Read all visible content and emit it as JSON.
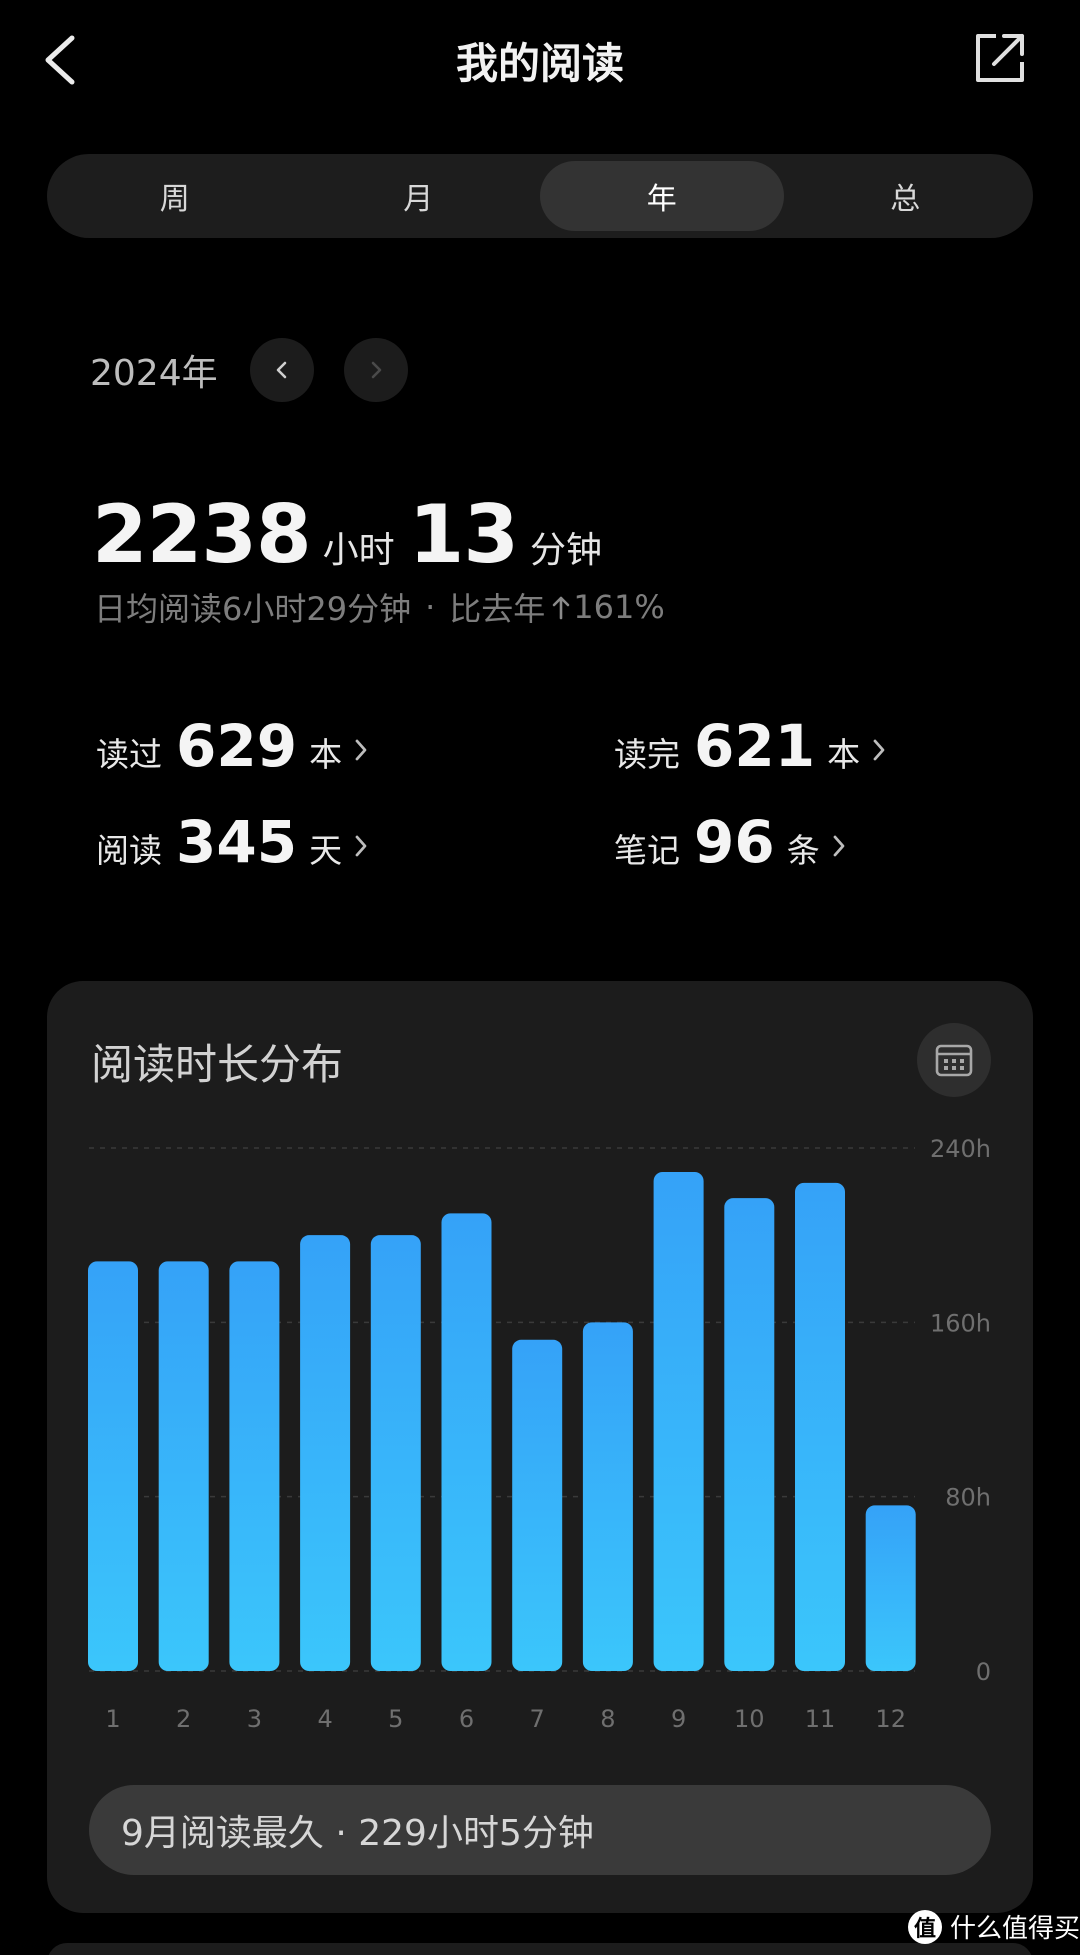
{
  "header": {
    "title": "我的阅读"
  },
  "tabs": [
    {
      "label": "周",
      "active": false
    },
    {
      "label": "月",
      "active": false
    },
    {
      "label": "年",
      "active": true
    },
    {
      "label": "总",
      "active": false
    }
  ],
  "year": {
    "label": "2024年"
  },
  "total": {
    "hours": "2238",
    "hours_unit": "小时",
    "minutes": "13",
    "minutes_unit": "分钟"
  },
  "summary": {
    "daily": "日均阅读6小时29分钟",
    "separator": "·",
    "compare": "比去年",
    "change": "161%"
  },
  "stats": {
    "read": {
      "label": "读过",
      "value": "629",
      "unit": "本"
    },
    "finished": {
      "label": "读完",
      "value": "621",
      "unit": "本"
    },
    "days": {
      "label": "阅读",
      "value": "345",
      "unit": "天"
    },
    "notes": {
      "label": "笔记",
      "value": "96",
      "unit": "条"
    }
  },
  "distribution": {
    "title": "阅读时长分布",
    "peak_text": "9月阅读最久 · 229小时5分钟"
  },
  "chart_data": {
    "type": "bar",
    "categories": [
      "1",
      "2",
      "3",
      "4",
      "5",
      "6",
      "7",
      "8",
      "9",
      "10",
      "11",
      "12"
    ],
    "values": [
      188,
      188,
      188,
      200,
      200,
      210,
      152,
      160,
      229,
      217,
      224,
      76
    ],
    "ylim": [
      0,
      240
    ],
    "yticks": [
      "0",
      "80h",
      "160h",
      "240h"
    ],
    "ytick_values": [
      0,
      80,
      160,
      240
    ],
    "grid": true,
    "bar_color_top": "#35a2f8",
    "bar_color_bottom": "#3bc6fb"
  },
  "watermark": {
    "logo": "值",
    "text": "什么值得买"
  },
  "colors": {
    "background": "#000000",
    "card": "#1c1c1c",
    "accent": "#38b3fa"
  }
}
